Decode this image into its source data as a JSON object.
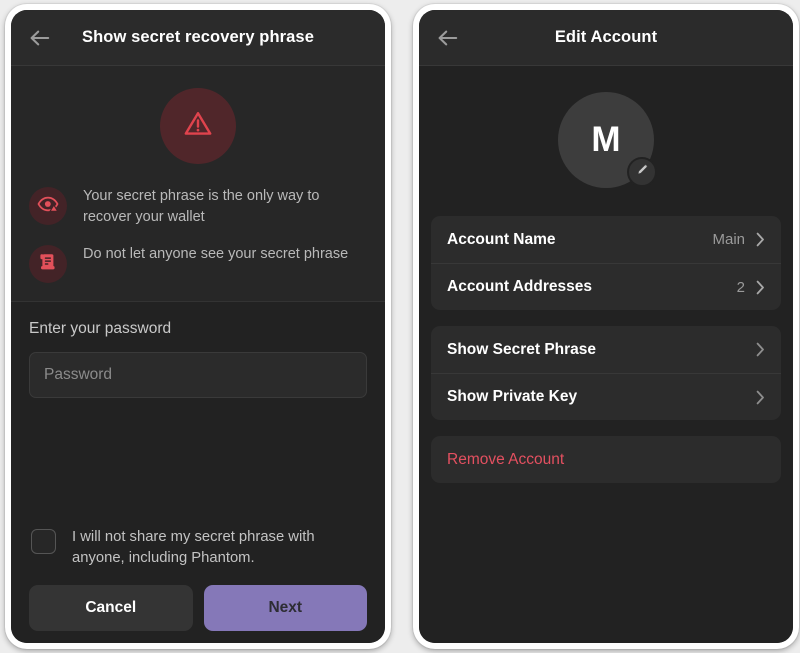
{
  "screens": {
    "left": {
      "header": {
        "title": "Show secret recovery phrase",
        "back_icon": "arrow-left-icon"
      },
      "alert_icon": "warning-triangle-icon",
      "warnings": [
        {
          "icon": "eye-warning-icon",
          "text": "Your secret phrase is the only way to recover your wallet"
        },
        {
          "icon": "scroll-document-icon",
          "text": "Do not let anyone see your secret phrase"
        }
      ],
      "password": {
        "label": "Enter your password",
        "placeholder": "Password",
        "value": ""
      },
      "consent": {
        "text": "I will not share my secret phrase with anyone, including Phantom.",
        "checked": false
      },
      "buttons": {
        "cancel": "Cancel",
        "next": "Next"
      }
    },
    "right": {
      "header": {
        "title": "Edit Account",
        "back_icon": "arrow-left-icon"
      },
      "avatar": {
        "letter": "M",
        "edit_icon": "pencil-icon"
      },
      "groups": [
        {
          "rows": [
            {
              "label": "Account Name",
              "value": "Main",
              "chevron": "chevron-right-icon"
            },
            {
              "label": "Account Addresses",
              "value": "2",
              "chevron": "chevron-right-icon"
            }
          ]
        },
        {
          "rows": [
            {
              "label": "Show Secret Phrase",
              "value": "",
              "chevron": "chevron-right-icon"
            },
            {
              "label": "Show Private Key",
              "value": "",
              "chevron": "chevron-right-icon"
            }
          ]
        }
      ],
      "danger": {
        "label": "Remove Account"
      }
    }
  },
  "colors": {
    "accent_purple": "#8578b8",
    "danger_red": "#e35060",
    "warning_red": "#e04a54",
    "screen_bg": "#222222",
    "header_bg": "#2b2b2b",
    "card_bg": "#2c2c2c"
  }
}
